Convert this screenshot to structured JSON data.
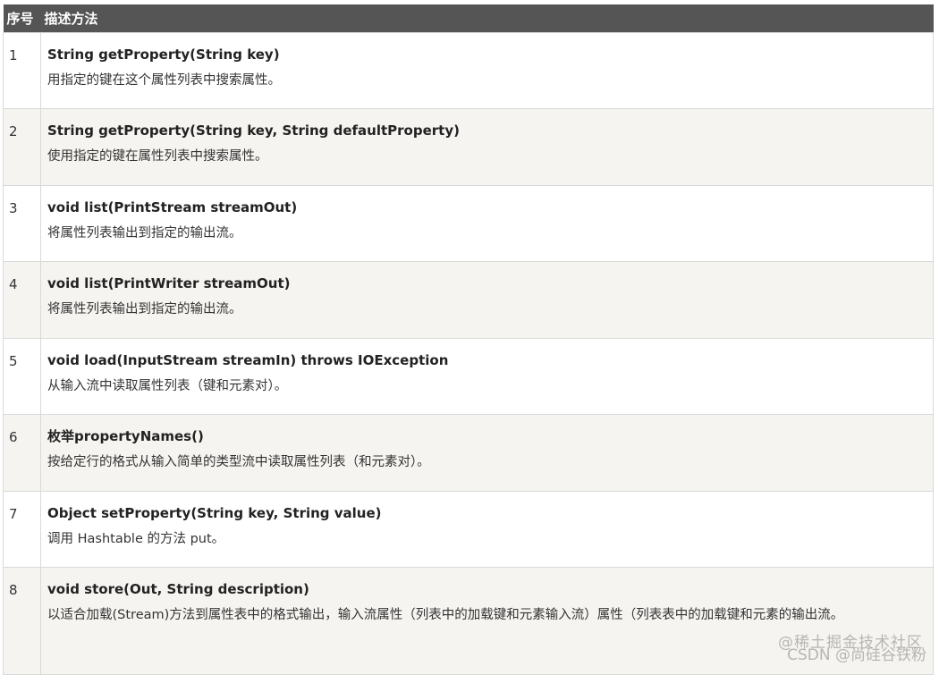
{
  "header": {
    "num_label": "序号",
    "desc_label": "描述方法"
  },
  "rows": [
    {
      "num": "1",
      "method": "String getProperty(String key)",
      "text": " 用指定的键在这个属性列表中搜索属性。"
    },
    {
      "num": "2",
      "method": "String getProperty(String key, String defaultProperty)",
      "text": "使用指定的键在属性列表中搜索属性。"
    },
    {
      "num": "3",
      "method": "void list(PrintStream streamOut)",
      "text": " 将属性列表输出到指定的输出流。"
    },
    {
      "num": "4",
      "method": "void list(PrintWriter streamOut)",
      "text": "将属性列表输出到指定的输出流。"
    },
    {
      "num": "5",
      "method": "void load(InputStream streamIn) throws IOException",
      "text": " 从输入流中读取属性列表（键和元素对）。"
    },
    {
      "num": "6",
      "method": "枚举propertyNames()",
      "text": "按给定行的格式从输入简单的类型流中读取属性列表（和元素对）。"
    },
    {
      "num": "7",
      "method": "Object setProperty(String key, String value)",
      "text": " 调用 Hashtable 的方法 put。"
    },
    {
      "num": "8",
      "method": "void store(Out, String description)",
      "text": " 以适合加载(Stream)方法到属性表中的格式输出，输入流属性（列表中的加载键和元素输入流）属性（列表表中的加载键和元素的输出流。"
    }
  ],
  "watermark": {
    "line1": "@稀土掘金技术社区",
    "line2": "CSDN @尚硅谷铁粉"
  }
}
